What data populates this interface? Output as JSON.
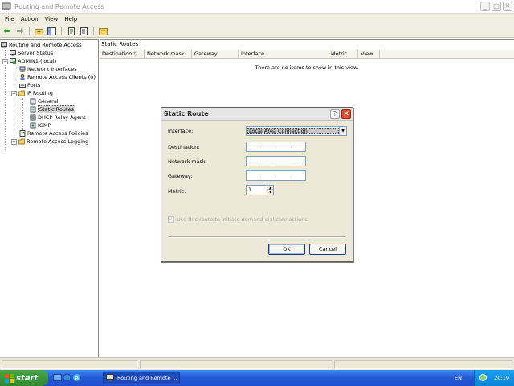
{
  "window": {
    "title": "Routing and Remote Access",
    "minimize": "_",
    "maximize": "□",
    "close": "✕"
  },
  "menu": {
    "file": "File",
    "action": "Action",
    "view": "View",
    "help": "Help"
  },
  "tree": {
    "root": "Routing and Remote Access",
    "server_status": "Server Status",
    "server": "ADMIN1 (local)",
    "network_interfaces": "Network Interfaces",
    "remote_access_clients": "Remote Access Clients (0)",
    "ports": "Ports",
    "ip_routing": "IP Routing",
    "general": "General",
    "static_routes": "Static Routes",
    "dhcp_relay_agent": "DHCP Relay Agent",
    "igmp": "IGMP",
    "remote_access_policies": "Remote Access Policies",
    "remote_access_logging": "Remote Access Logging"
  },
  "right": {
    "title": "Static Routes",
    "columns": [
      "Destination",
      "Network mask",
      "Gateway",
      "Interface",
      "Metric",
      "View"
    ],
    "empty_message": "There are no items to show in this view."
  },
  "dialog": {
    "title": "Static Route",
    "help": "?",
    "close": "✕",
    "interface_label": "Interface:",
    "interface_value": "Local Area Connection",
    "destination_label": "Destination:",
    "network_mask_label": "Network mask:",
    "gateway_label": "Gateway:",
    "metric_label": "Metric:",
    "metric_value": "1",
    "checkbox_label": "Use this route to initiate demand-dial connections",
    "ok": "OK",
    "cancel": "Cancel"
  },
  "taskbar": {
    "start": "start",
    "task": "Routing and Remote ...",
    "lang": "EN",
    "time": "20:19"
  },
  "colors": {
    "taskbar_blue": "#2459d6",
    "start_green": "#3a963a",
    "close_red": "#e04a2c",
    "tray_blue": "#0c83d6"
  }
}
